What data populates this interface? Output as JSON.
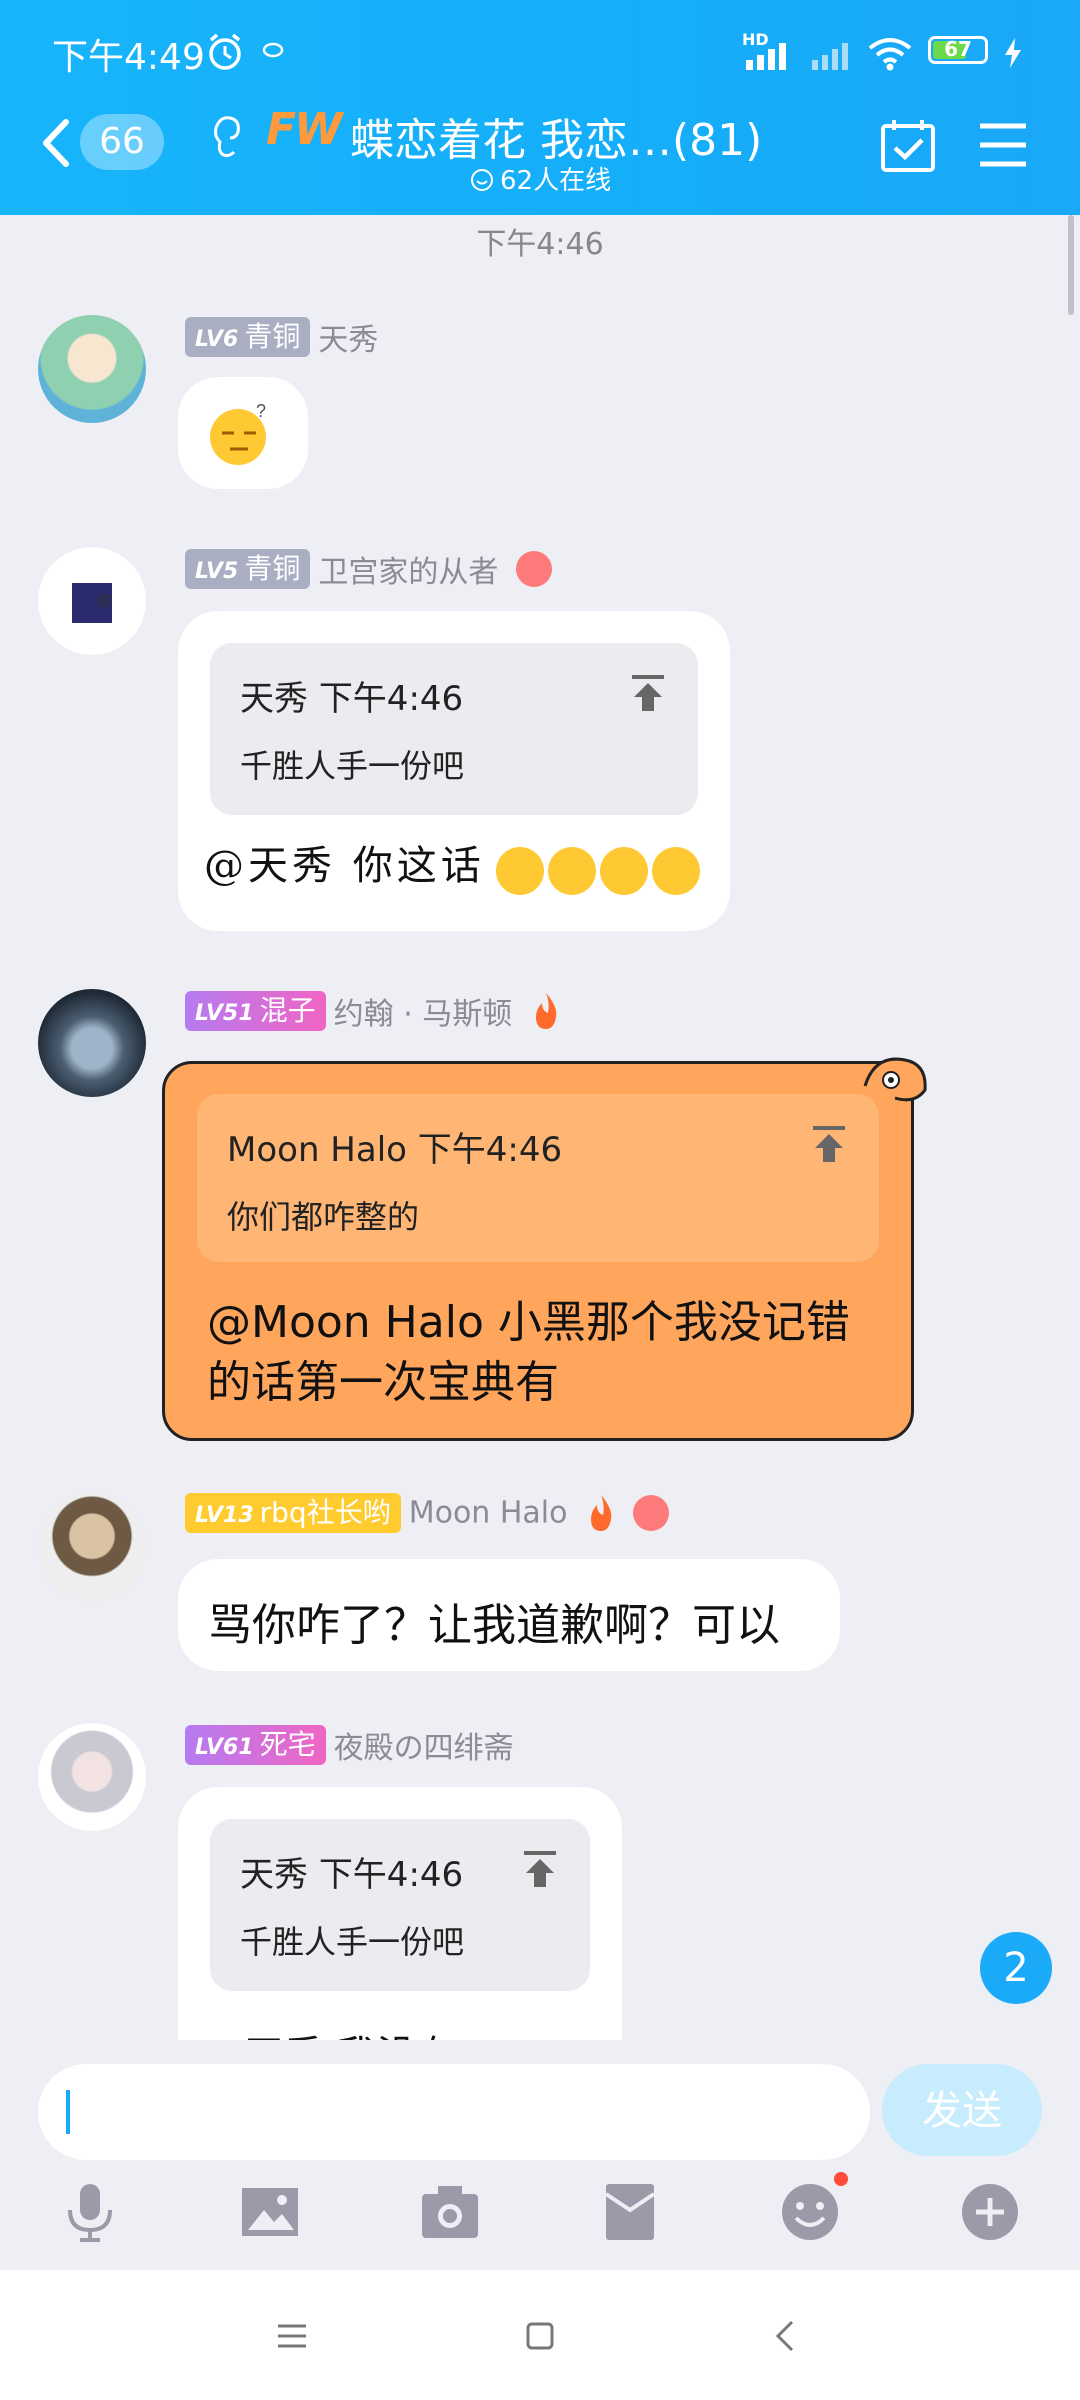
{
  "status_bar": {
    "time": "下午4:49",
    "network_label": "HD",
    "battery": "67"
  },
  "header": {
    "back_count": "66",
    "group_logo": "FW",
    "group_title": "蝶恋着花 我恋…(81)",
    "online_text": "62人在线"
  },
  "chat": {
    "timestamp": "下午4:46",
    "messages": [
      {
        "level": "LV6",
        "title": "青铜",
        "nickname": "天秀",
        "badge_color": "#a9aec3",
        "content_type": "emoji"
      },
      {
        "level": "LV5",
        "title": "青铜",
        "nickname": "卫宫家的从者",
        "badge_color": "#a9aec3",
        "quote_author": "天秀",
        "quote_time": "下午4:46",
        "quote_text": "千胜人手一份吧",
        "text": "@天秀 你这话"
      },
      {
        "level": "LV51",
        "title": "混子",
        "nickname": "约翰 · 马斯顿",
        "badge_color": "#e06bd8",
        "quote_author": "Moon Halo",
        "quote_time": "下午4:46",
        "quote_text": "你们都咋整的",
        "text_line1": "@Moon Halo 小黑那个我没记错",
        "text_line2": "的话第一次宝典有",
        "bubble_color": "#ffa55c"
      },
      {
        "level": "LV13",
        "title": "rbq社长哟",
        "nickname": "Moon Halo",
        "badge_color": "#ffcb2e",
        "text": "骂你咋了？让我道歉啊？可以"
      },
      {
        "level": "LV61",
        "title": "死宅",
        "nickname": "夜殿の四绯斋",
        "badge_color": "#d96ad8",
        "quote_author": "天秀",
        "quote_time": "下午4:46",
        "quote_text": "千胜人手一份吧",
        "text": "@天秀 我没有"
      }
    ]
  },
  "unread_count": "2",
  "input": {
    "value": "",
    "send_label": "发送"
  },
  "toolbar": {
    "items": [
      "voice-icon",
      "image-icon",
      "camera-icon",
      "red-packet-icon",
      "emoji-icon",
      "plus-icon"
    ]
  },
  "colors": {
    "header": "#18b5fb",
    "accent": "#1aaaf8",
    "background": "#eeeef5"
  }
}
